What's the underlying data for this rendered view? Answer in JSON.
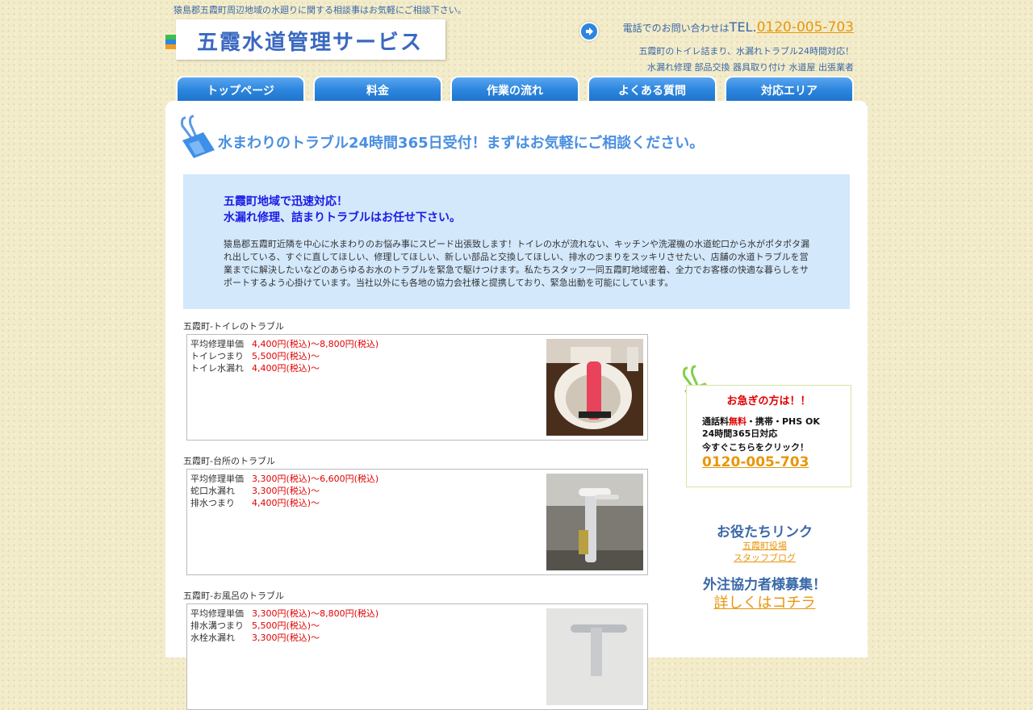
{
  "header": {
    "tagline": "猿島郡五霞町周辺地域の水廻りに関する相談事はお気軽にご相談下さい。",
    "logo_text": "五霞水道管理サービス",
    "logo_colors": [
      "#3dbf4a",
      "#2e86de",
      "#f29a1f"
    ],
    "contact_prefix": "電話でのお問い合わせは",
    "tel_label": "TEL.",
    "tel_number": "0120-005-703",
    "sub_line1": "五霞町のトイレ詰まり、水漏れトラブル24時間対応！",
    "sub_line2": "水漏れ修理 部品交換 器具取り付け 水道屋 出張業者"
  },
  "nav": {
    "tabs": [
      "トップページ",
      "料金",
      "作業の流れ",
      "よくある質問",
      "対応エリア"
    ]
  },
  "main": {
    "headline": "水まわりのトラブル24時間365日受付！まずはお気軽にご相談ください。",
    "intro_heading1": "五霞町地域で迅速対応！",
    "intro_heading2": "水漏れ修理、詰まりトラブルはお任せ下さい。",
    "intro_text": "猿島郡五霞町近隣を中心に水まわりのお悩み事にスピード出張致します！トイレの水が流れない、キッチンや洗濯機の水道蛇口から水がポタポタ漏れ出している、すぐに直してほしい、修理してほしい、新しい部品と交換してほしい、排水のつまりをスッキリさせたい、店舗の水道トラブルを営業までに解決したいなどのあらゆるお水のトラブルを緊急で駆けつけます。私たちスタッフ一同五霞町地域密着、全力でお客様の快適な暮らしをサポートするよう心掛けています。当社以外にも各地の協力会社様と提携しており、緊急出動を可能にしています。",
    "sections": [
      {
        "title": "五霞町-トイレのトラブル",
        "rows": [
          {
            "label": "平均修理単価",
            "value": "4,400円(税込)～8,800円(税込)"
          },
          {
            "label": "トイレつまり",
            "value": "5,500円(税込)～"
          },
          {
            "label": "トイレ水漏れ",
            "value": "4,400円(税込)～"
          }
        ]
      },
      {
        "title": "五霞町-台所のトラブル",
        "rows": [
          {
            "label": "平均修理単価",
            "value": "3,300円(税込)～6,600円(税込)"
          },
          {
            "label": "蛇口水漏れ",
            "value": "3,300円(税込)～"
          },
          {
            "label": "排水つまり",
            "value": "4,400円(税込)～"
          }
        ]
      },
      {
        "title": "五霞町-お風呂のトラブル",
        "rows": [
          {
            "label": "平均修理単価",
            "value": "3,300円(税込)～8,800円(税込)"
          },
          {
            "label": "排水溝つまり",
            "value": "5,500円(税込)～"
          },
          {
            "label": "水栓水漏れ",
            "value": "3,300円(税込)～"
          }
        ]
      }
    ]
  },
  "sidebar": {
    "urgent_title": "お急ぎの方は！！",
    "call_prefix": "通話料",
    "call_free": "無料",
    "call_suffix": "・携帯・PHS OK",
    "hours": "24時間365日対応",
    "click_here": "今すぐこちらをクリック！",
    "tel_number": "0120-005-703",
    "links_title": "お役たちリンク",
    "links": [
      "五霞町役場",
      "スタッフブログ"
    ],
    "partner_title": "外注協力者様募集！",
    "partner_link": "詳しくはコチラ"
  }
}
